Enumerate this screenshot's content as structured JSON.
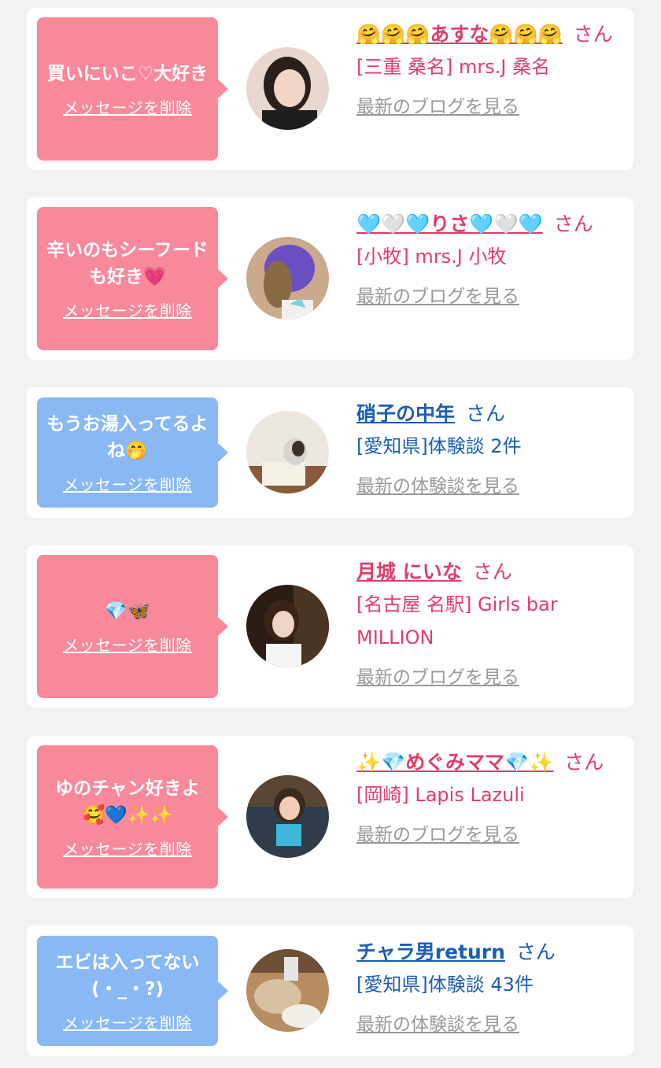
{
  "delete_label": "メッセージを削除",
  "san": "さん",
  "colors": {
    "pink": "#f7899b",
    "blue": "#8ab8f5",
    "name_pink": "#e23c69",
    "name_blue": "#1b5eb5",
    "link_gray": "#999999"
  },
  "items": [
    {
      "message": "買いにいこ♡大好き",
      "name": "🤗🤗🤗あすな🤗🤗🤗",
      "sub": "[三重 桑名] mrs.J 桑名",
      "link": "最新のブログを見る",
      "theme": "pink"
    },
    {
      "message": "辛いのもシーフードも好き💗",
      "name": "🩵🤍🩵りさ🩵🤍🩵",
      "sub": "[小牧] mrs.J 小牧",
      "link": "最新のブログを見る",
      "theme": "pink"
    },
    {
      "message": "もうお湯入ってるよね🤭",
      "name": "硝子の中年",
      "sub": "[愛知県]体験談 2件",
      "link": "最新の体験談を見る",
      "theme": "blue"
    },
    {
      "message": "💎🦋",
      "name": "月城 にいな",
      "sub": "[名古屋 名駅] Girls bar MILLION",
      "link": "最新のブログを見る",
      "theme": "pink"
    },
    {
      "message": "ゆのチャン好きよ🥰💙✨✨",
      "name": "✨💎めぐみママ💎✨",
      "sub": "[岡崎] Lapis Lazuli",
      "link": "最新のブログを見る",
      "theme": "pink"
    },
    {
      "message": "エビは入ってない(・_・?)",
      "name": "チャラ男return",
      "sub": "[愛知県]体験談 43件",
      "link": "最新の体験談を見る",
      "theme": "blue"
    }
  ]
}
